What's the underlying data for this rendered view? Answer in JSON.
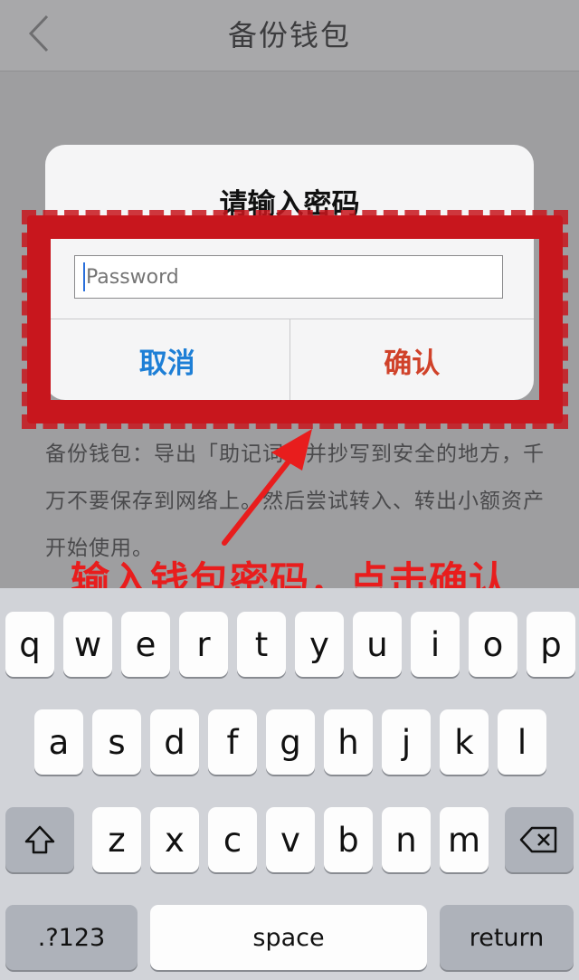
{
  "nav": {
    "title": "备份钱包",
    "back_icon": "chevron-left-icon"
  },
  "background_text": "备份钱包：导出「助记词」并抄写到安全的地方，千万不要保存到网络上。然后尝试转入、转出小额资产开始使用。",
  "dialog": {
    "title": "请输入密码",
    "password_placeholder": "Password",
    "cancel_label": "取消",
    "confirm_label": "确认"
  },
  "annotation": {
    "caption": "输入钱包密码，点击确认"
  },
  "colors": {
    "stamp_red": "#c8161d",
    "cancel_blue": "#1e7fd6",
    "confirm_red": "#d0422a",
    "caption_red": "#e81d1d"
  },
  "keyboard": {
    "row1": [
      "q",
      "w",
      "e",
      "r",
      "t",
      "y",
      "u",
      "i",
      "o",
      "p"
    ],
    "row2": [
      "a",
      "s",
      "d",
      "f",
      "g",
      "h",
      "j",
      "k",
      "l"
    ],
    "row3": [
      "z",
      "x",
      "c",
      "v",
      "b",
      "n",
      "m"
    ],
    "shift_icon": "shift-arrow-icon",
    "delete_icon": "backspace-icon",
    "numbers_label": ".?123",
    "space_label": "space",
    "return_label": "return"
  }
}
